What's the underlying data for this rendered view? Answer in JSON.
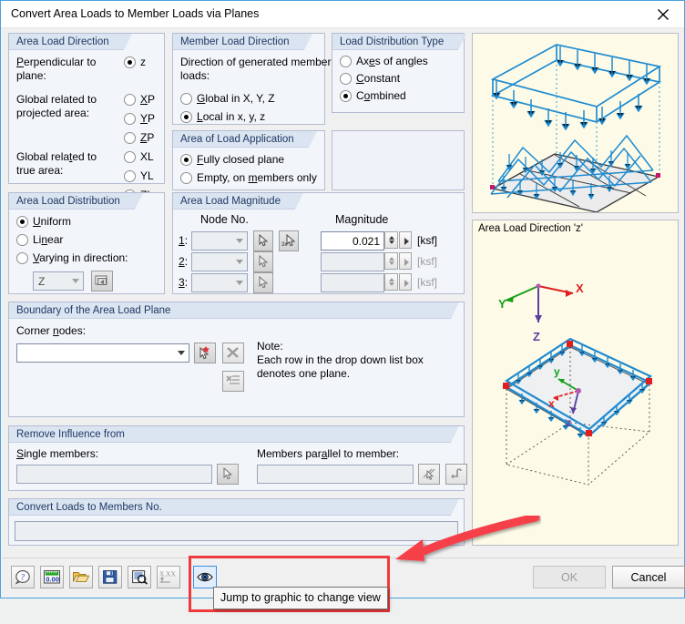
{
  "window": {
    "title": "Convert Area Loads to Member Loads via Planes",
    "close_icon": "close-icon"
  },
  "area_load_direction": {
    "title": "Area Load Direction",
    "labels": {
      "perpendicular": "Perpendicular to plane:",
      "projected": "Global related to projected area:",
      "true_area": "Global related to true area:"
    },
    "options": [
      {
        "label": "z",
        "selected": true
      },
      {
        "label": "XP",
        "selected": false
      },
      {
        "label": "YP",
        "selected": false
      },
      {
        "label": "ZP",
        "selected": false
      },
      {
        "label": "XL",
        "selected": false
      },
      {
        "label": "YL",
        "selected": false
      },
      {
        "label": "ZL",
        "selected": false
      }
    ]
  },
  "area_load_distribution": {
    "title": "Area Load Distribution",
    "options": [
      {
        "label": "Uniform",
        "selected": true
      },
      {
        "label": "Linear",
        "selected": false
      },
      {
        "label": "Varying in direction:",
        "selected": false
      }
    ],
    "direction_value": "Z",
    "direction_picker_icon": "pick-direction-icon"
  },
  "member_load_direction": {
    "title": "Member Load Direction",
    "caption": "Direction of generated member loads:",
    "options": [
      {
        "label": "Global in X, Y, Z",
        "selected": false
      },
      {
        "label": "Local in x, y, z",
        "selected": true
      }
    ]
  },
  "area_of_load_application": {
    "title": "Area of Load Application",
    "options": [
      {
        "label": "Fully closed plane",
        "selected": true
      },
      {
        "label": "Empty, on members only",
        "selected": false
      }
    ]
  },
  "load_distribution_type": {
    "title": "Load Distribution Type",
    "options": [
      {
        "label": "Axes of angles",
        "selected": false
      },
      {
        "label": "Constant",
        "selected": false
      },
      {
        "label": "Combined",
        "selected": true
      }
    ]
  },
  "area_load_magnitude": {
    "title": "Area Load Magnitude",
    "col_node": "Node No.",
    "col_magnitude": "Magnitude",
    "rows": [
      {
        "index": "1:",
        "node": "",
        "magnitude": "0.021",
        "unit": "[ksf]",
        "enabled": true,
        "pick_icon": "pick-node-icon",
        "pick3_icon": "pick-three-nodes-icon"
      },
      {
        "index": "2:",
        "node": "",
        "magnitude": "",
        "unit": "[ksf]",
        "enabled": false,
        "pick_icon": "pick-node-icon"
      },
      {
        "index": "3:",
        "node": "",
        "magnitude": "",
        "unit": "[ksf]",
        "enabled": false,
        "pick_icon": "pick-node-icon"
      }
    ]
  },
  "boundary": {
    "title": "Boundary of the Area Load Plane",
    "corner_nodes_label": "Corner nodes:",
    "corner_nodes_value": "",
    "pick_icon": "pick-corner-nodes-icon",
    "delete_icon": "delete-plane-icon",
    "list_icon": "plane-list-icon",
    "note_title": "Note:",
    "note_line1": "Each row in the drop down list box",
    "note_line2": "denotes one plane."
  },
  "remove_influence": {
    "title": "Remove Influence from",
    "single_members_label": "Single members:",
    "single_members_value": "",
    "single_pick_icon": "pick-members-icon",
    "parallel_label": "Members parallel to member:",
    "parallel_value": "",
    "parallel_pick_icon": "pick-parallel-member-icon",
    "parallel_extra_icon": "member-direction-icon"
  },
  "convert_loads": {
    "title": "Convert Loads to Members No.",
    "value": ""
  },
  "toolbar": {
    "icons": [
      {
        "name": "help-icon",
        "glyph": "?"
      },
      {
        "name": "units-icon",
        "glyph": "0.00"
      },
      {
        "name": "open-icon",
        "glyph": "folder"
      },
      {
        "name": "save-icon",
        "glyph": "disk"
      },
      {
        "name": "preview-icon",
        "glyph": "magnifier"
      },
      {
        "name": "decimals-icon",
        "glyph": "X.XX"
      },
      {
        "name": "view-graphic-icon",
        "glyph": "eye",
        "selected": true
      }
    ]
  },
  "buttons": {
    "ok": "OK",
    "ok_enabled": false,
    "cancel": "Cancel"
  },
  "tooltip": {
    "text": "Jump to graphic to change view"
  },
  "graphics": {
    "top_panel_name": "load-conversion-illustration",
    "bottom_panel_label": "Area Load Direction 'z'",
    "axes": {
      "x": "X",
      "y": "Y",
      "z": "Z",
      "lx": "x",
      "ly": "y",
      "lz": "z"
    }
  },
  "colors": {
    "accent_blue": "#1f8bd0",
    "group_header": "#dbe5f1",
    "group_header_text": "#1f3864",
    "annotation_red": "#ef3a3a",
    "graphic_bg": "#fdfbe8",
    "axis_x": "#e02020",
    "axis_y": "#16a016",
    "axis_z": "#5a3fa0"
  }
}
